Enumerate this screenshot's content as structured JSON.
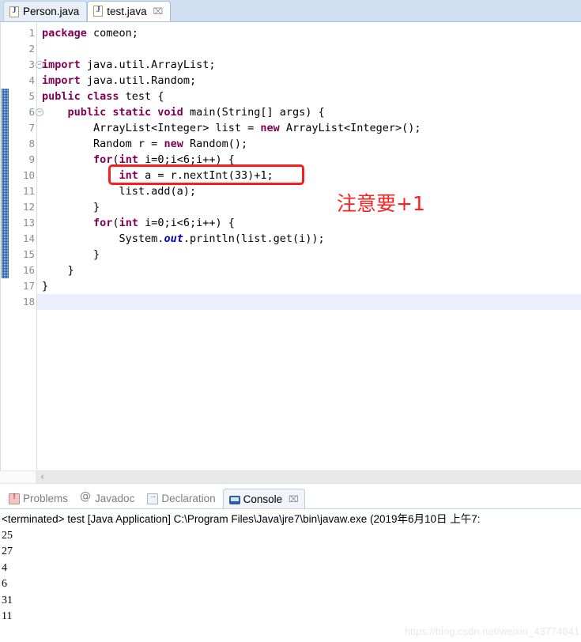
{
  "editor_tabs": [
    {
      "label": "Person.java",
      "icon": "java-file-icon",
      "active": false,
      "closable": false
    },
    {
      "label": "test.java",
      "icon": "java-file-icon",
      "active": true,
      "closable": true,
      "close_glyph": "⌧"
    }
  ],
  "code": {
    "lines": [
      {
        "n": "1",
        "fold": false,
        "changed": false,
        "current": false,
        "tokens": [
          {
            "t": "package",
            "c": "kw"
          },
          {
            "t": " comeon;",
            "c": "pl"
          }
        ]
      },
      {
        "n": "2",
        "fold": false,
        "changed": false,
        "current": false,
        "tokens": [
          {
            "t": "",
            "c": "pl"
          }
        ]
      },
      {
        "n": "3",
        "fold": true,
        "changed": false,
        "current": false,
        "tokens": [
          {
            "t": "import",
            "c": "kw"
          },
          {
            "t": " java.util.ArrayList;",
            "c": "pl"
          }
        ]
      },
      {
        "n": "4",
        "fold": false,
        "changed": false,
        "current": false,
        "tokens": [
          {
            "t": "import",
            "c": "kw"
          },
          {
            "t": " java.util.Random;",
            "c": "pl"
          }
        ]
      },
      {
        "n": "5",
        "fold": false,
        "changed": true,
        "current": false,
        "tokens": [
          {
            "t": "public class",
            "c": "kw"
          },
          {
            "t": " test {",
            "c": "pl"
          }
        ]
      },
      {
        "n": "6",
        "fold": true,
        "changed": true,
        "current": false,
        "tokens": [
          {
            "t": "    ",
            "c": "pl"
          },
          {
            "t": "public static void",
            "c": "kw"
          },
          {
            "t": " main(String[] args) {",
            "c": "pl"
          }
        ]
      },
      {
        "n": "7",
        "fold": false,
        "changed": true,
        "current": false,
        "tokens": [
          {
            "t": "        ArrayList<Integer> list = ",
            "c": "pl"
          },
          {
            "t": "new",
            "c": "kw"
          },
          {
            "t": " ArrayList<Integer>();",
            "c": "pl"
          }
        ]
      },
      {
        "n": "8",
        "fold": false,
        "changed": true,
        "current": false,
        "tokens": [
          {
            "t": "        Random r = ",
            "c": "pl"
          },
          {
            "t": "new",
            "c": "kw"
          },
          {
            "t": " Random();",
            "c": "pl"
          }
        ]
      },
      {
        "n": "9",
        "fold": false,
        "changed": true,
        "current": false,
        "tokens": [
          {
            "t": "        ",
            "c": "pl"
          },
          {
            "t": "for",
            "c": "kw"
          },
          {
            "t": "(",
            "c": "pl"
          },
          {
            "t": "int",
            "c": "kw"
          },
          {
            "t": " i=0;i<6;i++) {",
            "c": "pl"
          }
        ]
      },
      {
        "n": "10",
        "fold": false,
        "changed": true,
        "current": false,
        "tokens": [
          {
            "t": "            ",
            "c": "pl"
          },
          {
            "t": "int",
            "c": "kw"
          },
          {
            "t": " a = r.nextInt(33)+1;",
            "c": "pl"
          }
        ]
      },
      {
        "n": "11",
        "fold": false,
        "changed": true,
        "current": false,
        "tokens": [
          {
            "t": "            list.add(a);",
            "c": "pl"
          }
        ]
      },
      {
        "n": "12",
        "fold": false,
        "changed": true,
        "current": false,
        "tokens": [
          {
            "t": "        }",
            "c": "pl"
          }
        ]
      },
      {
        "n": "13",
        "fold": false,
        "changed": true,
        "current": false,
        "tokens": [
          {
            "t": "        ",
            "c": "pl"
          },
          {
            "t": "for",
            "c": "kw"
          },
          {
            "t": "(",
            "c": "pl"
          },
          {
            "t": "int",
            "c": "kw"
          },
          {
            "t": " i=0;i<6;i++) {",
            "c": "pl"
          }
        ]
      },
      {
        "n": "14",
        "fold": false,
        "changed": true,
        "current": false,
        "tokens": [
          {
            "t": "            System.",
            "c": "pl"
          },
          {
            "t": "out",
            "c": "st"
          },
          {
            "t": ".println(list.get(i));",
            "c": "pl"
          }
        ]
      },
      {
        "n": "15",
        "fold": false,
        "changed": true,
        "current": false,
        "tokens": [
          {
            "t": "        }",
            "c": "pl"
          }
        ]
      },
      {
        "n": "16",
        "fold": false,
        "changed": true,
        "current": false,
        "tokens": [
          {
            "t": "    }",
            "c": "pl"
          }
        ]
      },
      {
        "n": "17",
        "fold": false,
        "changed": true,
        "current": false,
        "tokens": [
          {
            "t": "}",
            "c": "pl"
          }
        ]
      },
      {
        "n": "18",
        "fold": false,
        "changed": false,
        "current": true,
        "tokens": [
          {
            "t": "",
            "c": "pl"
          }
        ]
      }
    ]
  },
  "annotations": {
    "highlight_box_color": "#fb1d1d",
    "note_text": "注意要+1",
    "note_color": "#ff1f1f"
  },
  "editor_scrollbar": {
    "left_arrow": "‹"
  },
  "panel_tabs": [
    {
      "label": "Problems",
      "icon": "problems-icon",
      "active": false,
      "closable": false
    },
    {
      "label": "Javadoc",
      "icon": "javadoc-icon",
      "active": false,
      "closable": false
    },
    {
      "label": "Declaration",
      "icon": "declaration-icon",
      "active": false,
      "closable": false
    },
    {
      "label": "Console",
      "icon": "console-icon",
      "active": true,
      "closable": true,
      "close_glyph": "⌧"
    }
  ],
  "console": {
    "status_line": "<terminated> test [Java Application] C:\\Program Files\\Java\\jre7\\bin\\javaw.exe (2019年6月10日 上午7:",
    "output": [
      "25",
      "27",
      "4",
      "6",
      "31",
      "11"
    ]
  },
  "watermark": "https://blog.csdn.net/weixin_43774841"
}
